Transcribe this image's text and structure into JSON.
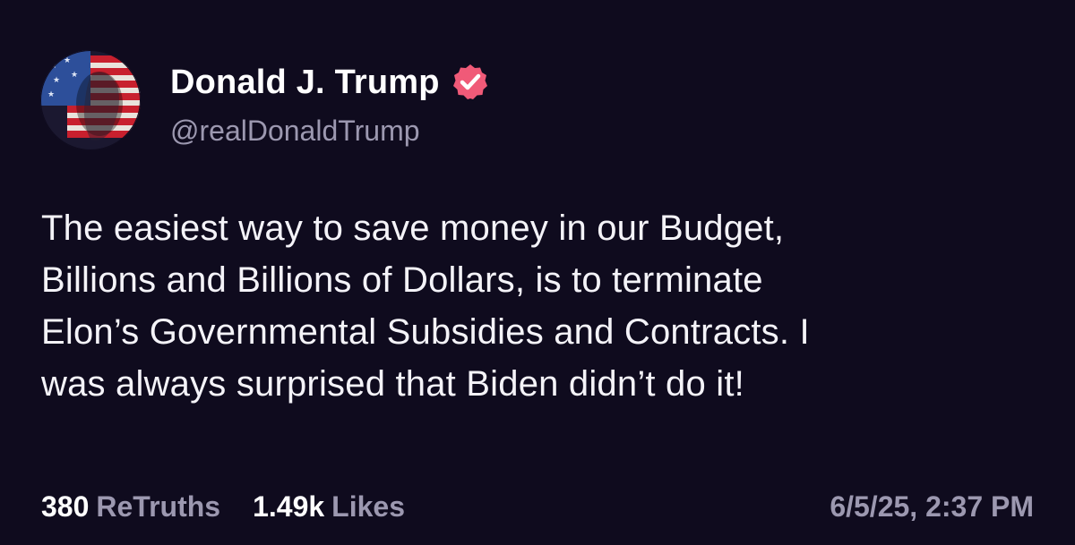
{
  "post": {
    "author": {
      "display_name": "Donald J. Trump",
      "handle": "@realDonaldTrump",
      "verified": true,
      "verified_badge_color": "#f05a78",
      "avatar_icon": "flag-painted-face-avatar"
    },
    "body": {
      "lines": [
        "The easiest way to save money in our Budget,",
        "Billions and Billions of Dollars, is to terminate",
        "Elon’s Governmental Subsidies and Contracts. I",
        "was always surprised that Biden didn’t do it!"
      ]
    },
    "stats": {
      "retruths_count": "380",
      "retruths_label": "ReTruths",
      "likes_count": "1.49k",
      "likes_label": "Likes"
    },
    "timestamp": "6/5/25, 2:37 PM"
  },
  "colors": {
    "background": "#0f0b1e",
    "primary_text": "#ffffff",
    "secondary_text": "#9c98b0",
    "accent": "#f05a78"
  }
}
